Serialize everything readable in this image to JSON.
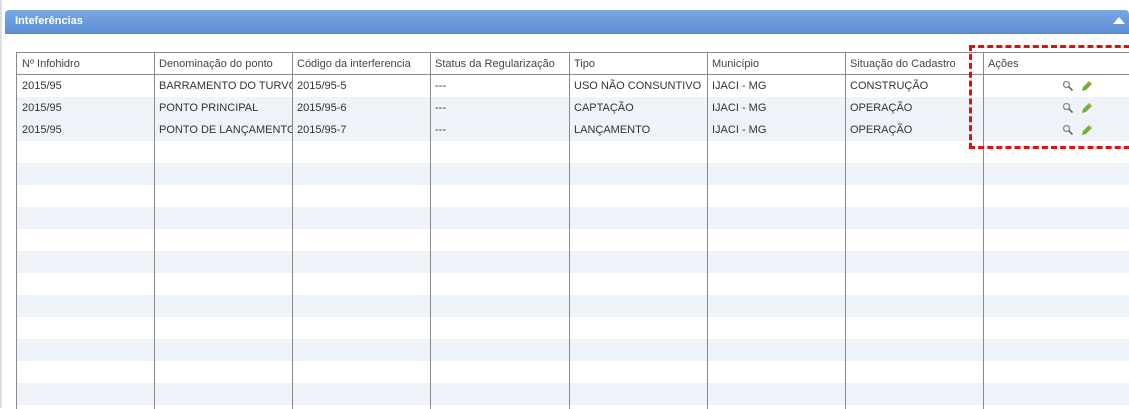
{
  "panel": {
    "title": "Inteferências"
  },
  "table": {
    "headers": [
      "Nº Infohidro",
      "Denominação do ponto",
      "Código da interferencia",
      "Status da Regularização",
      "Tipo",
      "Município",
      "Situação do Cadastro",
      "Ações"
    ],
    "rows": [
      [
        "2015/95",
        "BARRAMENTO DO TURVO",
        "2015/95-5",
        "---",
        "USO NÃO CONSUNTIVO",
        "IJACI - MG",
        "CONSTRUÇÃO"
      ],
      [
        "2015/95",
        "PONTO PRINCIPAL",
        "2015/95-6",
        "---",
        "CAPTAÇÃO",
        "IJACI - MG",
        "OPERAÇÃO"
      ],
      [
        "2015/95",
        "PONTO DE LANÇAMENTO",
        "2015/95-7",
        "---",
        "LANÇAMENTO",
        "IJACI - MG",
        "OPERAÇÃO"
      ]
    ],
    "row_actions": [
      "view-icon",
      "edit-icon"
    ]
  },
  "colors": {
    "header": "#5b8ed6",
    "stripe": "#eef3fa",
    "highlight": "#e01010"
  }
}
